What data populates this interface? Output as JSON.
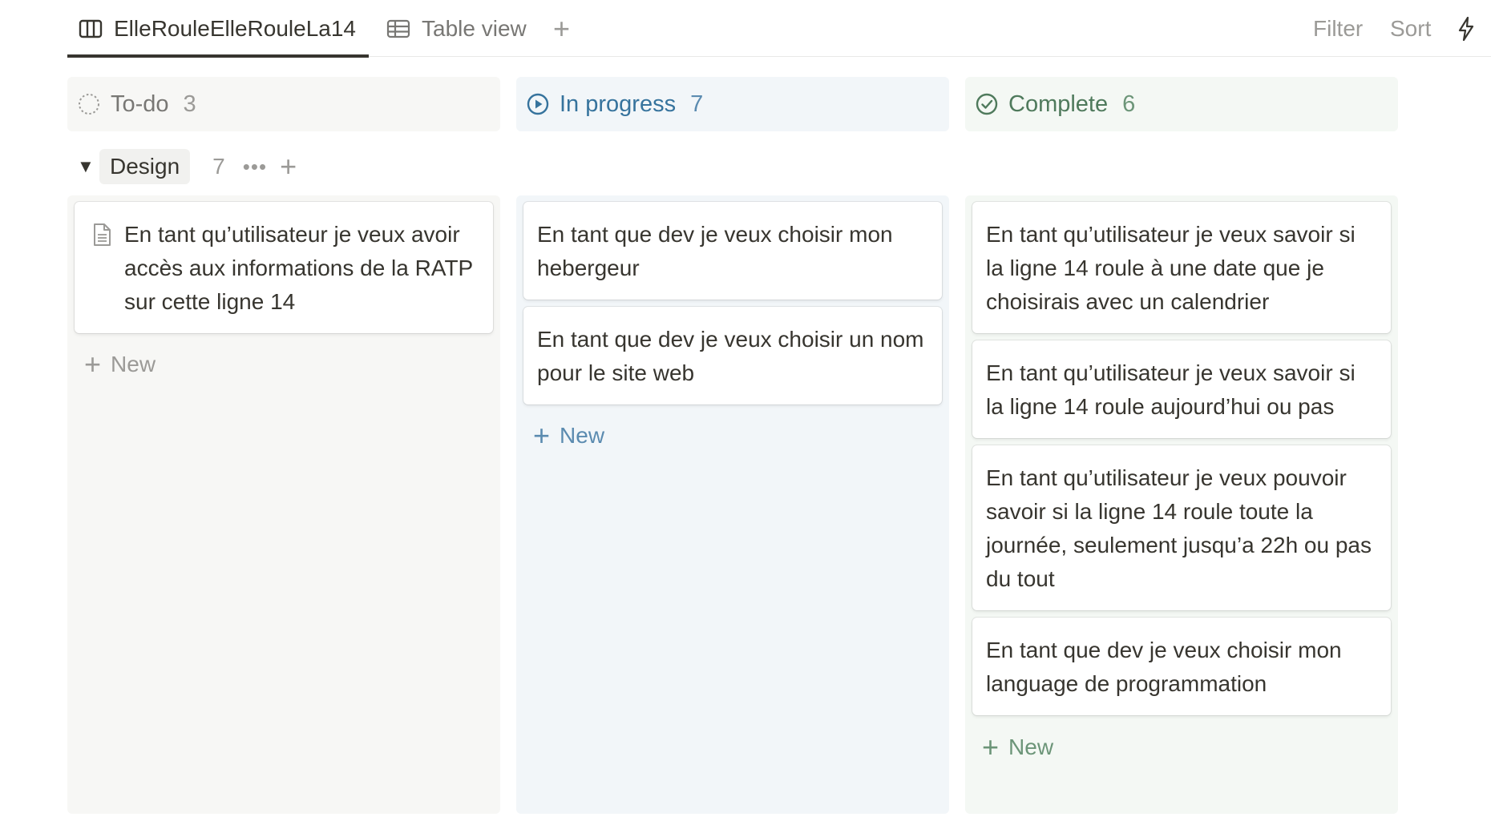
{
  "views": {
    "board_label": "ElleRouleElleRouleLa14",
    "table_label": "Table view",
    "add_label": "+"
  },
  "toolbar": {
    "filter": "Filter",
    "sort": "Sort",
    "automation_icon": "lightning-icon"
  },
  "columns": [
    {
      "name": "To-do",
      "count": "3",
      "color": "#787774",
      "icon": "dashed-circle-icon"
    },
    {
      "name": "In progress",
      "count": "7",
      "color": "#36739d",
      "icon": "play-circle-icon"
    },
    {
      "name": "Complete",
      "count": "6",
      "color": "#4f7a5c",
      "icon": "check-circle-icon"
    }
  ],
  "group": {
    "name": "Design",
    "count": "7",
    "more": "•••",
    "add": "+"
  },
  "cards": {
    "todo": [
      "En tant qu’utilisateur je veux avoir accès aux informations de la RATP sur cette ligne 14"
    ],
    "in_progress": [
      "En tant que dev je veux choisir mon hebergeur",
      "En tant que dev je veux choisir un nom pour le site web"
    ],
    "complete": [
      "En tant qu’utilisateur je veux savoir si la ligne 14 roule à une date que je choisirais avec un calendrier",
      "En tant qu’utilisateur je veux savoir si la ligne 14 roule aujourd’hui ou pas",
      "En tant qu’utilisateur je veux pouvoir savoir si la ligne 14 roule toute la journée, seulement jusqu’a 22h ou pas du tout",
      "En tant que dev je veux choisir mon language de programmation"
    ]
  },
  "new_label": "New"
}
